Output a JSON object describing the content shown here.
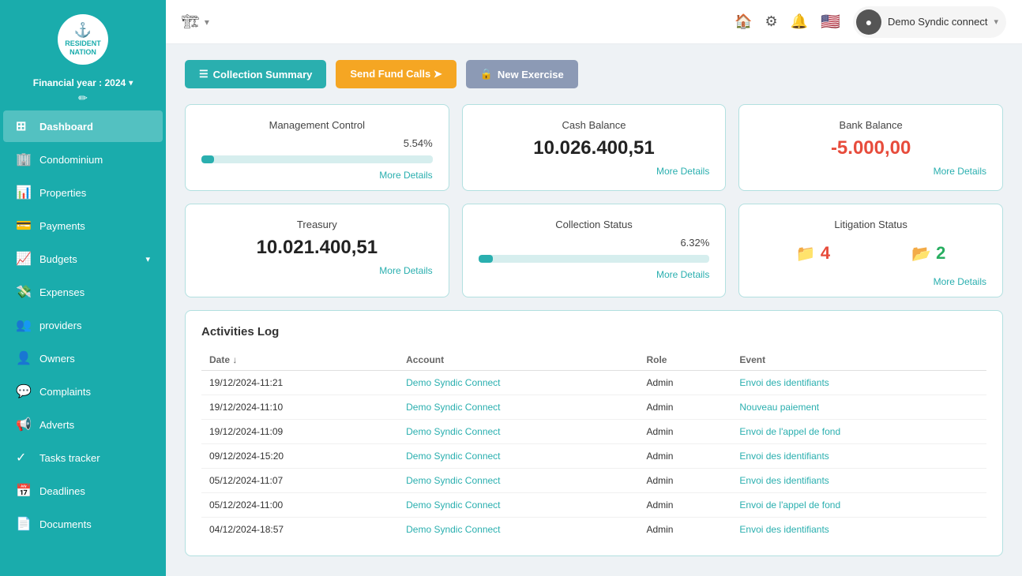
{
  "sidebar": {
    "logo": {
      "line1": "RESIDENT",
      "line2": "NATION"
    },
    "financial_year": "Financial year : 2024",
    "nav_items": [
      {
        "id": "dashboard",
        "label": "Dashboard",
        "icon": "⊞",
        "active": true
      },
      {
        "id": "condominium",
        "label": "Condominium",
        "icon": "🏢",
        "active": false
      },
      {
        "id": "properties",
        "label": "Properties",
        "icon": "📊",
        "active": false
      },
      {
        "id": "payments",
        "label": "Payments",
        "icon": "💳",
        "active": false
      },
      {
        "id": "budgets",
        "label": "Budgets",
        "icon": "📈",
        "active": false,
        "arrow": "▾"
      },
      {
        "id": "expenses",
        "label": "Expenses",
        "icon": "💸",
        "active": false
      },
      {
        "id": "providers",
        "label": "providers",
        "icon": "👥",
        "active": false
      },
      {
        "id": "owners",
        "label": "Owners",
        "icon": "👤",
        "active": false
      },
      {
        "id": "complaints",
        "label": "Complaints",
        "icon": "💬",
        "active": false
      },
      {
        "id": "adverts",
        "label": "Adverts",
        "icon": "📢",
        "active": false
      },
      {
        "id": "tasks",
        "label": "Tasks tracker",
        "icon": "✓",
        "active": false
      },
      {
        "id": "deadlines",
        "label": "Deadlines",
        "icon": "📅",
        "active": false
      },
      {
        "id": "documents",
        "label": "Documents",
        "icon": "📄",
        "active": false
      }
    ]
  },
  "topbar": {
    "building_icon": "🏗",
    "icons": [
      "⚙",
      "🔔",
      "🇺🇸"
    ],
    "user": {
      "name": "Demo Syndic connect",
      "avatar": "●"
    }
  },
  "action_bar": {
    "collection_summary": "Collection Summary",
    "send_fund_calls": "Send Fund Calls ➤",
    "new_exercise": "New Exercise"
  },
  "cards": {
    "management_control": {
      "title": "Management Control",
      "percent": "5.54%",
      "progress": 5.54,
      "more": "More Details"
    },
    "cash_balance": {
      "title": "Cash Balance",
      "value": "10.026.400,51",
      "more": "More Details"
    },
    "bank_balance": {
      "title": "Bank Balance",
      "value": "-5.000,00",
      "more": "More Details"
    },
    "treasury": {
      "title": "Treasury",
      "value": "10.021.400,51",
      "more": "More Details"
    },
    "collection_status": {
      "title": "Collection Status",
      "percent": "6.32%",
      "progress": 6.32,
      "more": "More Details"
    },
    "litigation_status": {
      "title": "Litigation Status",
      "red_count": "4",
      "green_count": "2",
      "more": "More Details"
    }
  },
  "activities": {
    "title": "Activities Log",
    "columns": [
      "Date",
      "Account",
      "Role",
      "Event"
    ],
    "rows": [
      {
        "date": "19/12/2024-11:21",
        "account": "Demo Syndic Connect",
        "role": "Admin",
        "event": "Envoi des identifiants"
      },
      {
        "date": "19/12/2024-11:10",
        "account": "Demo Syndic Connect",
        "role": "Admin",
        "event": "Nouveau paiement"
      },
      {
        "date": "19/12/2024-11:09",
        "account": "Demo Syndic Connect",
        "role": "Admin",
        "event": "Envoi de l'appel de fond"
      },
      {
        "date": "09/12/2024-15:20",
        "account": "Demo Syndic Connect",
        "role": "Admin",
        "event": "Envoi des identifiants"
      },
      {
        "date": "05/12/2024-11:07",
        "account": "Demo Syndic Connect",
        "role": "Admin",
        "event": "Envoi des identifiants"
      },
      {
        "date": "05/12/2024-11:00",
        "account": "Demo Syndic Connect",
        "role": "Admin",
        "event": "Envoi de l'appel de fond"
      },
      {
        "date": "04/12/2024-18:57",
        "account": "Demo Syndic Connect",
        "role": "Admin",
        "event": "Envoi des identifiants"
      }
    ]
  }
}
